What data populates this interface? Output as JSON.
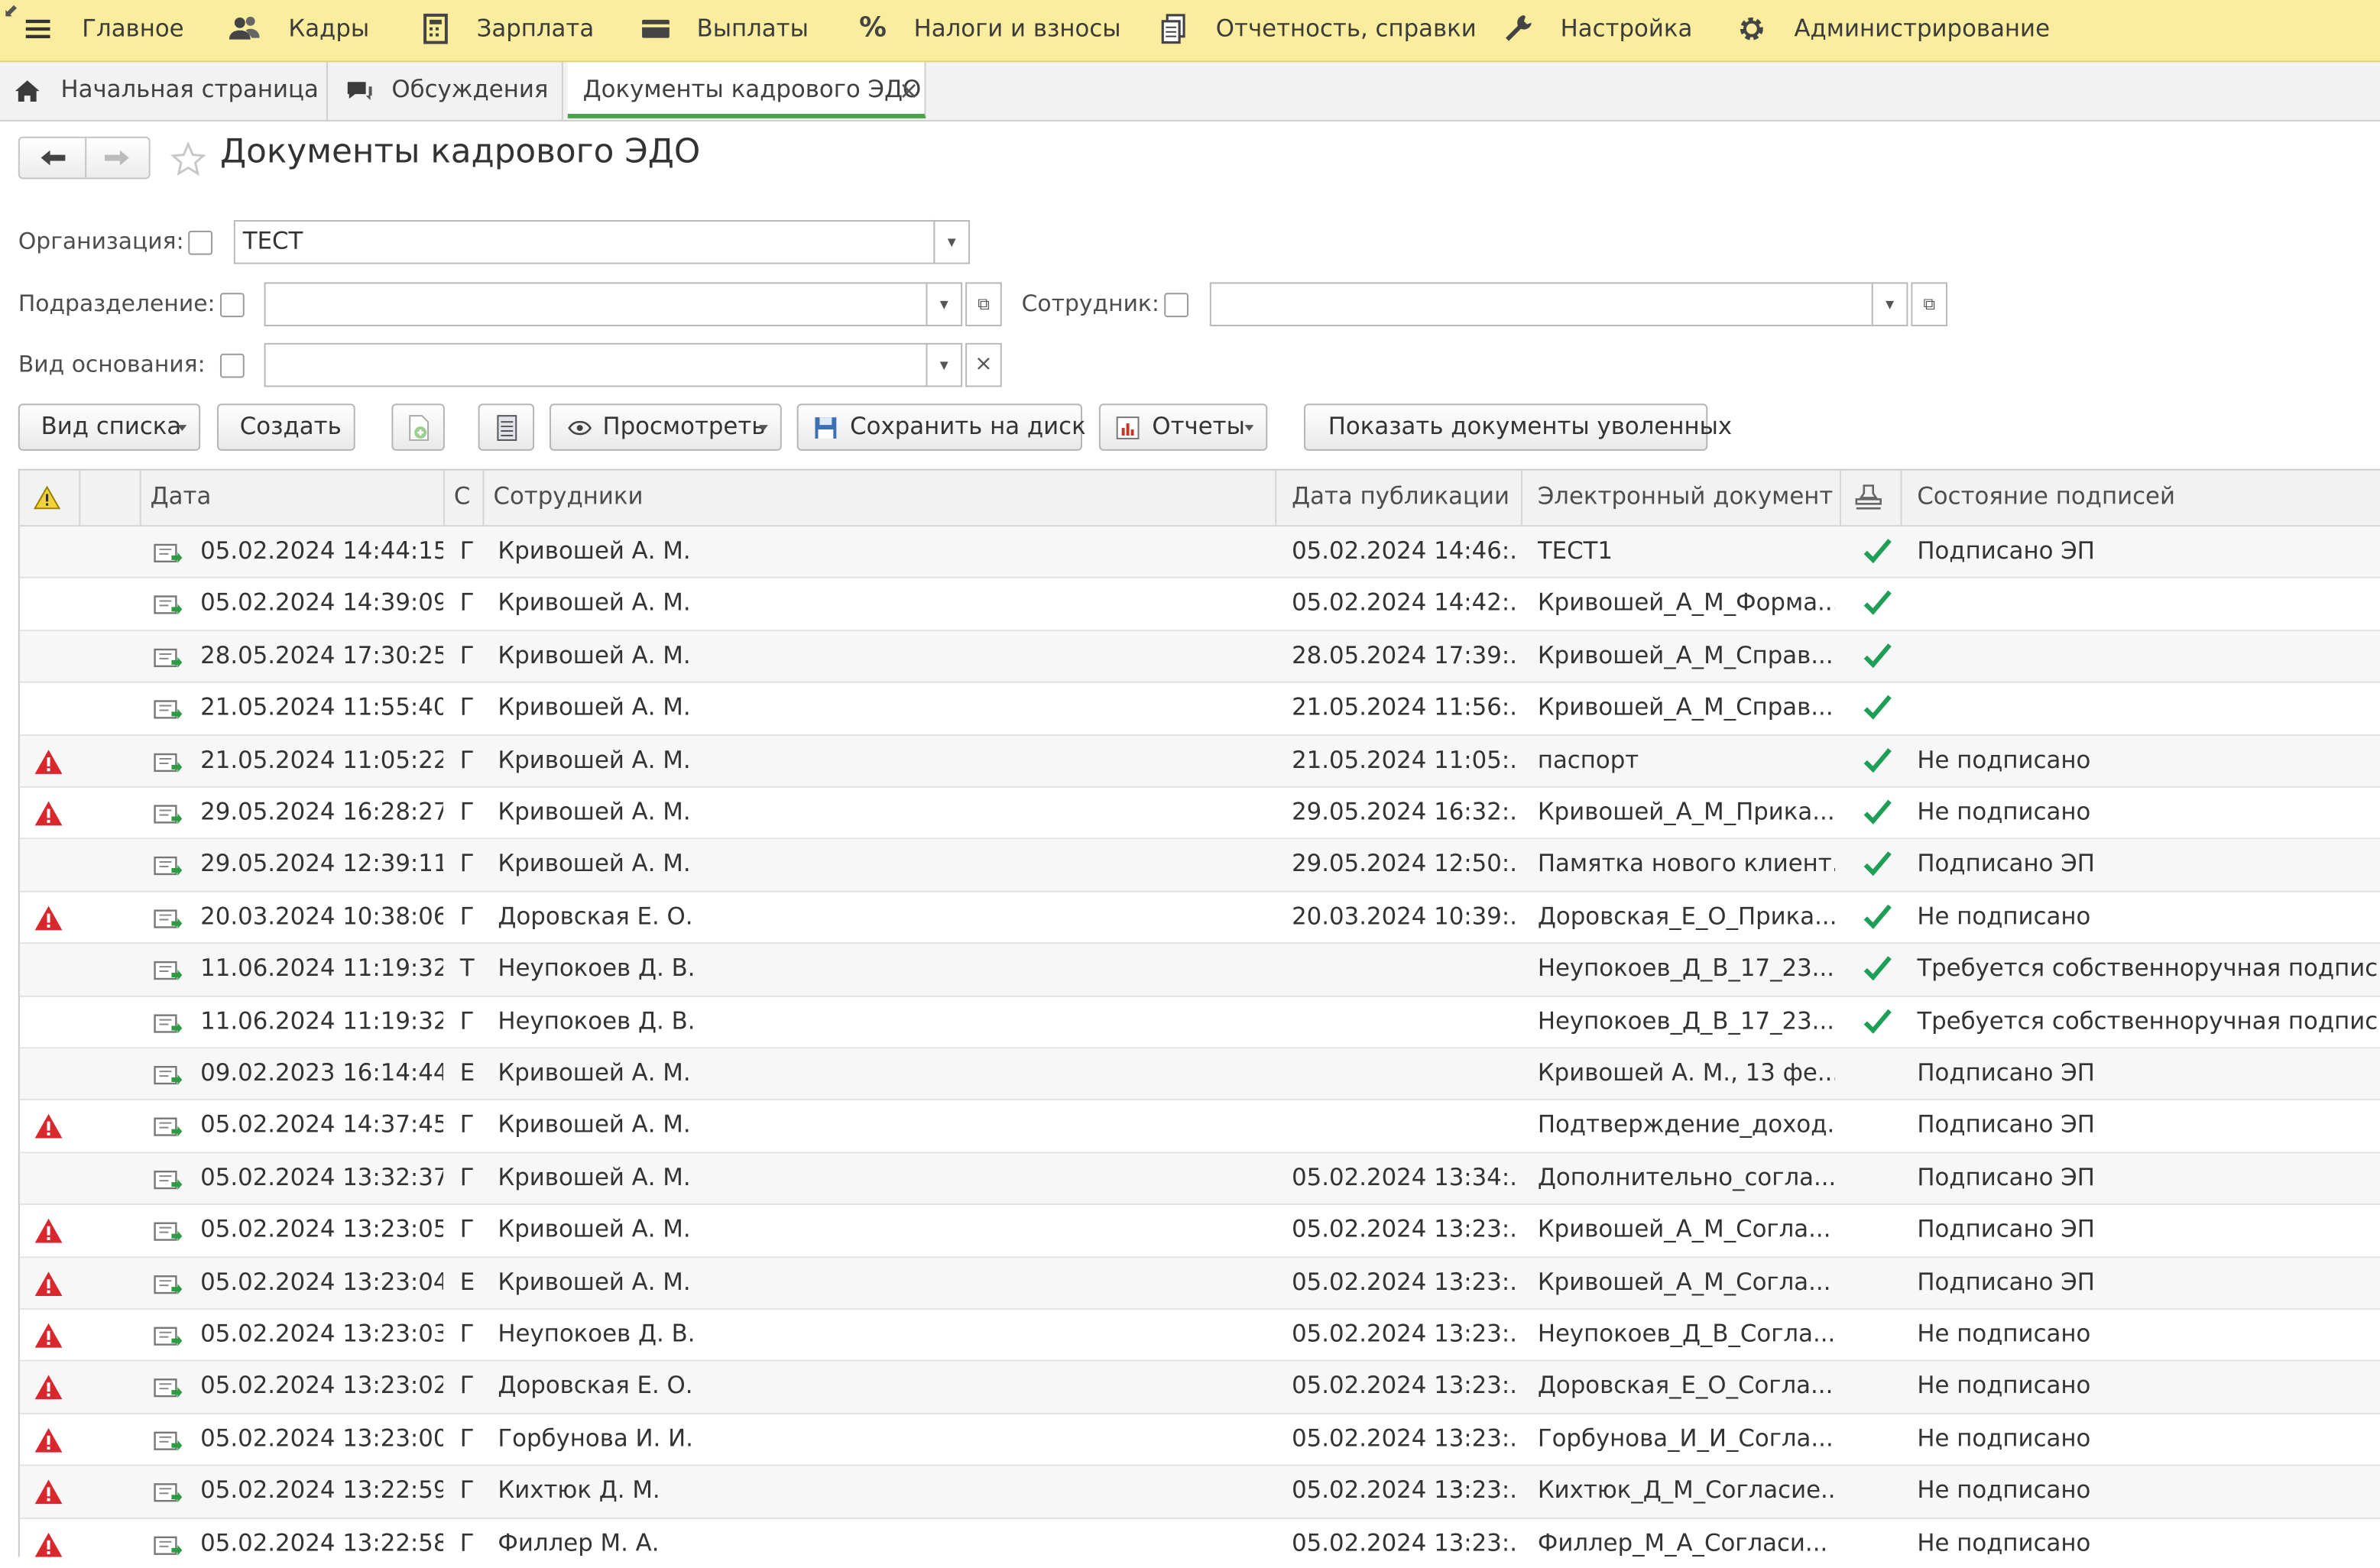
{
  "top_menu": {
    "items": [
      {
        "label": "Главное",
        "icon": "hamburger-icon"
      },
      {
        "label": "Кадры",
        "icon": "people-icon"
      },
      {
        "label": "Зарплата",
        "icon": "calculator-icon"
      },
      {
        "label": "Выплаты",
        "icon": "wallet-icon"
      },
      {
        "label": "Налоги и взносы",
        "icon": "percent-icon"
      },
      {
        "label": "Отчетность, справки",
        "icon": "reports-icon"
      },
      {
        "label": "Настройка",
        "icon": "wrench-icon"
      },
      {
        "label": "Администрирование",
        "icon": "gear-icon"
      }
    ]
  },
  "tabs": [
    {
      "label": "Начальная страница",
      "icon": "home-icon"
    },
    {
      "label": "Обсуждения",
      "icon": "chat-icon"
    },
    {
      "label": "Документы кадрового ЭДО",
      "active": true
    }
  ],
  "page": {
    "title": "Документы кадрового ЭДО"
  },
  "filters": {
    "organization_label": "Организация:",
    "organization_value": "ТЕСТ",
    "department_label": "Подразделение:",
    "department_value": "",
    "employee_label": "Сотрудник:",
    "employee_value": "",
    "basis_label": "Вид основания:",
    "basis_value": ""
  },
  "toolbar": {
    "list_view": "Вид списка",
    "create": "Создать",
    "view": "Просмотреть",
    "save_to_disk": "Сохранить на диск",
    "reports": "Отчеты",
    "show_dismissed": "Показать документы уволенных"
  },
  "table": {
    "columns": [
      "Дата",
      "С",
      "Сотрудники",
      "Дата публикации",
      "Электронный документ",
      "Состояние подписей"
    ],
    "rows": [
      {
        "warn": false,
        "date": "05.02.2024 14:44:15",
        "s": "Г",
        "employee": "Кривошей А. М.",
        "pub": "05.02.2024 14:46:...",
        "doc": "ТЕСТ1",
        "check": true,
        "state": "Подписано ЭП"
      },
      {
        "warn": false,
        "date": "05.02.2024 14:39:09",
        "s": "Г",
        "employee": "Кривошей А. М.",
        "pub": "05.02.2024 14:42:...",
        "doc": "Кривошей_А_М_Форма...",
        "check": true,
        "state": ""
      },
      {
        "warn": false,
        "date": "28.05.2024 17:30:25",
        "s": "Г",
        "employee": "Кривошей А. М.",
        "pub": "28.05.2024 17:39:...",
        "doc": "Кривошей_А_М_Справ...",
        "check": true,
        "state": ""
      },
      {
        "warn": false,
        "date": "21.05.2024 11:55:40",
        "s": "Г",
        "employee": "Кривошей А. М.",
        "pub": "21.05.2024 11:56:...",
        "doc": "Кривошей_А_М_Справ...",
        "check": true,
        "state": ""
      },
      {
        "warn": true,
        "date": "21.05.2024 11:05:22",
        "s": "Г",
        "employee": "Кривошей А. М.",
        "pub": "21.05.2024 11:05:...",
        "doc": "паспорт",
        "check": true,
        "state": "Не подписано"
      },
      {
        "warn": true,
        "date": "29.05.2024 16:28:27",
        "s": "Г",
        "employee": "Кривошей А. М.",
        "pub": "29.05.2024 16:32:...",
        "doc": "Кривошей_А_М_Прика...",
        "check": true,
        "state": "Не подписано"
      },
      {
        "warn": false,
        "date": "29.05.2024 12:39:11",
        "s": "Г",
        "employee": "Кривошей А. М.",
        "pub": "29.05.2024 12:50:...",
        "doc": "Памятка нового клиент...",
        "check": true,
        "state": "Подписано ЭП"
      },
      {
        "warn": true,
        "date": "20.03.2024 10:38:06",
        "s": "Г",
        "employee": "Доровская Е. О.",
        "pub": "20.03.2024 10:39:...",
        "doc": "Доровская_Е_О_Прика...",
        "check": true,
        "state": "Не подписано"
      },
      {
        "warn": false,
        "date": "11.06.2024 11:19:32",
        "s": "Т",
        "employee": "Неупокоев Д. В.",
        "pub": "",
        "doc": "Неупокоев_Д_В_17_23...",
        "check": true,
        "state": "Требуется собственноручная подпись"
      },
      {
        "warn": false,
        "date": "11.06.2024 11:19:32",
        "s": "Г",
        "employee": "Неупокоев Д. В.",
        "pub": "",
        "doc": "Неупокоев_Д_В_17_23...",
        "check": true,
        "state": "Требуется собственноручная подпись"
      },
      {
        "warn": false,
        "date": "09.02.2023 16:14:44",
        "s": "Е",
        "employee": "Кривошей А. М.",
        "pub": "",
        "doc": "Кривошей А. М., 13 фе...",
        "check": false,
        "state": "Подписано ЭП"
      },
      {
        "warn": true,
        "date": "05.02.2024 14:37:45",
        "s": "Г",
        "employee": "Кривошей А. М.",
        "pub": "",
        "doc": "Подтверждение_доход...",
        "check": false,
        "state": "Подписано ЭП"
      },
      {
        "warn": false,
        "date": "05.02.2024 13:32:37",
        "s": "Г",
        "employee": "Кривошей А. М.",
        "pub": "05.02.2024 13:34:...",
        "doc": "Дополнительно_согла...",
        "check": false,
        "state": "Подписано ЭП"
      },
      {
        "warn": true,
        "date": "05.02.2024 13:23:05",
        "s": "Г",
        "employee": "Кривошей А. М.",
        "pub": "05.02.2024 13:23:...",
        "doc": "Кривошей_А_М_Согла...",
        "check": false,
        "state": "Подписано ЭП"
      },
      {
        "warn": true,
        "date": "05.02.2024 13:23:04",
        "s": "Е",
        "employee": "Кривошей А. М.",
        "pub": "05.02.2024 13:23:...",
        "doc": "Кривошей_А_М_Согла...",
        "check": false,
        "state": "Подписано ЭП"
      },
      {
        "warn": true,
        "date": "05.02.2024 13:23:03",
        "s": "Г",
        "employee": "Неупокоев Д. В.",
        "pub": "05.02.2024 13:23:...",
        "doc": "Неупокоев_Д_В_Согла...",
        "check": false,
        "state": "Не подписано"
      },
      {
        "warn": true,
        "date": "05.02.2024 13:23:02",
        "s": "Г",
        "employee": "Доровская Е. О.",
        "pub": "05.02.2024 13:23:...",
        "doc": "Доровская_Е_О_Согла...",
        "check": false,
        "state": "Не подписано"
      },
      {
        "warn": true,
        "date": "05.02.2024 13:23:00",
        "s": "Г",
        "employee": "Горбунова И. И.",
        "pub": "05.02.2024 13:23:...",
        "doc": "Горбунова_И_И_Согла...",
        "check": false,
        "state": "Не подписано"
      },
      {
        "warn": true,
        "date": "05.02.2024 13:22:59",
        "s": "Г",
        "employee": "Кихтюк Д. М.",
        "pub": "05.02.2024 13:23:...",
        "doc": "Кихтюк_Д_М_Согласие...",
        "check": false,
        "state": "Не подписано"
      },
      {
        "warn": true,
        "date": "05.02.2024 13:22:58",
        "s": "Г",
        "employee": "Филлер М. А.",
        "pub": "05.02.2024 13:23:...",
        "doc": "Филлер_М_А_Согласи...",
        "check": false,
        "state": "Не подписано"
      }
    ]
  },
  "colors": {
    "menu_bg": "#fbed9e",
    "active_tab_accent": "#4aa24a",
    "warning_red": "#d9272e",
    "check_green": "#1f9e57"
  }
}
